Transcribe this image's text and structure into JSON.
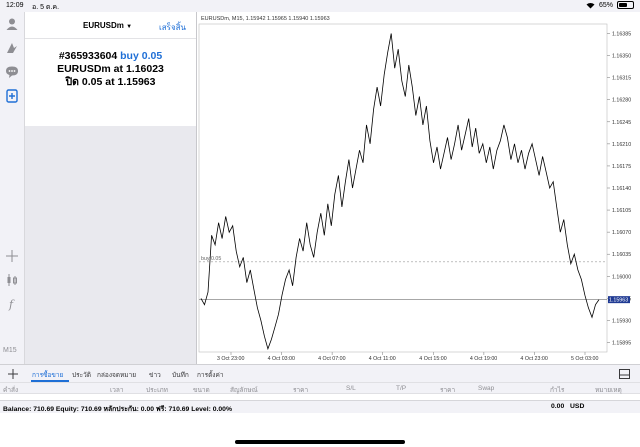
{
  "status_bar": {
    "time": "12:09",
    "date": "อ. 5 ต.ค.",
    "battery_text": "65%",
    "battery_level": 0.65
  },
  "left_toolbar": {
    "icons": [
      "accounts-icon",
      "signal-icon",
      "chat-icon",
      "new-order-icon",
      "crosshair-icon",
      "candle-icon",
      "indicator-icon"
    ],
    "timeframe": "M15"
  },
  "order_panel": {
    "symbol": "EURUSDm",
    "done_label": "เสร็จสิ้น",
    "line1_ticket": "#365933604",
    "line1_action": "buy 0.05",
    "line2_prefix": "EURUSDm at",
    "line2_price": "1.16023",
    "line3_prefix": "ปิด 0.05 at",
    "line3_price": "1.15963"
  },
  "chart": {
    "header": "EURUSDm, M15, 1.15942 1.15965 1.15940 1.15963",
    "order_line_label": "buy 0.05",
    "current_price_label": "1.15963"
  },
  "chart_data": {
    "type": "line",
    "y_ticks": [
      "1.16385",
      "1.16350",
      "1.16315",
      "1.16280",
      "1.16245",
      "1.16210",
      "1.16175",
      "1.16140",
      "1.16105",
      "1.16070",
      "1.16035",
      "1.16000",
      "1.15965",
      "1.15930",
      "1.15895"
    ],
    "x_ticks": [
      "3 Oct 23:00",
      "4 Oct 03:00",
      "4 Oct 07:00",
      "4 Oct 11:00",
      "4 Oct 15:00",
      "4 Oct 19:00",
      "4 Oct 23:00",
      "5 Oct 03:00"
    ],
    "ylim": [
      1.1588,
      1.164
    ],
    "order_price": 1.16023,
    "current_price": 1.15963,
    "values": [
      1.15965,
      1.15955,
      1.15975,
      1.16065,
      1.1605,
      1.16085,
      1.1606,
      1.16095,
      1.1607,
      1.1608,
      1.1604,
      1.16015,
      1.1603,
      1.1599,
      1.1601,
      1.1598,
      1.1595,
      1.1593,
      1.15905,
      1.15885,
      1.159,
      1.1592,
      1.1594,
      1.1597,
      1.15995,
      1.1601,
      1.15985,
      1.1603,
      1.1606,
      1.1604,
      1.16085,
      1.1605,
      1.1603,
      1.1607,
      1.161,
      1.16065,
      1.16115,
      1.1608,
      1.1613,
      1.1616,
      1.1611,
      1.1615,
      1.16185,
      1.1614,
      1.1617,
      1.162,
      1.1618,
      1.1624,
      1.1621,
      1.16265,
      1.163,
      1.1627,
      1.1632,
      1.16355,
      1.16385,
      1.1633,
      1.1636,
      1.1631,
      1.16285,
      1.16335,
      1.163,
      1.16255,
      1.16285,
      1.1624,
      1.1627,
      1.16215,
      1.1618,
      1.16205,
      1.1617,
      1.16195,
      1.1622,
      1.16185,
      1.1621,
      1.1624,
      1.162,
      1.16225,
      1.1625,
      1.16205,
      1.16235,
      1.16195,
      1.1621,
      1.1618,
      1.16205,
      1.1617,
      1.162,
      1.16215,
      1.1624,
      1.1622,
      1.16185,
      1.1621,
      1.1618,
      1.162,
      1.1617,
      1.16195,
      1.1621,
      1.16185,
      1.1616,
      1.1619,
      1.16165,
      1.1614,
      1.1615,
      1.1611,
      1.1607,
      1.1609,
      1.1605,
      1.1602,
      1.16035,
      1.1601,
      1.15995,
      1.1597,
      1.1595,
      1.15935,
      1.15955,
      1.15963
    ]
  },
  "tabs": [
    "การซื้อขาย",
    "ประวัติ",
    "กล่องจดหมาย",
    "ข่าว",
    "บันทึก",
    "การตั้งค่า"
  ],
  "columns": [
    "คำสั่ง",
    "เวลา",
    "ประเภท",
    "ขนาด",
    "สัญลักษณ์",
    "ราคา",
    "S/L",
    "T/P",
    "ราคา",
    "Swap",
    "กำไร",
    "หมายเหตุ"
  ],
  "balance": {
    "text": "Balance: 710.69 Equity: 710.69 หลักประกัน: 0.00 ฟรี: 710.69 Level: 0.00%",
    "profit": "0.00",
    "currency": "USD"
  },
  "colors": {
    "accent": "#1f6fd6",
    "chart_line": "#000000",
    "order_line": "#9a9a9a"
  }
}
